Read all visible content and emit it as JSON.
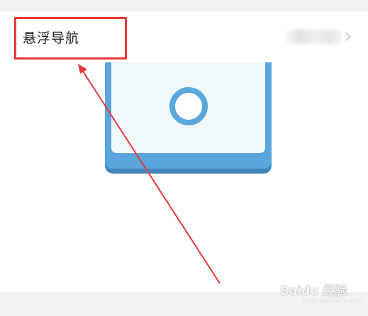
{
  "setting": {
    "title": "悬浮导航"
  },
  "watermark": {
    "brand": "Baidu 经验",
    "url": "jingyan.baidu.com"
  },
  "colors": {
    "phone_blue": "#5ba6dc",
    "screen_bg": "#f0f8fc",
    "annotation_red": "#e8383a"
  },
  "icons": {
    "home_button": "ring-icon",
    "row_arrow": "chevron-right-icon"
  }
}
